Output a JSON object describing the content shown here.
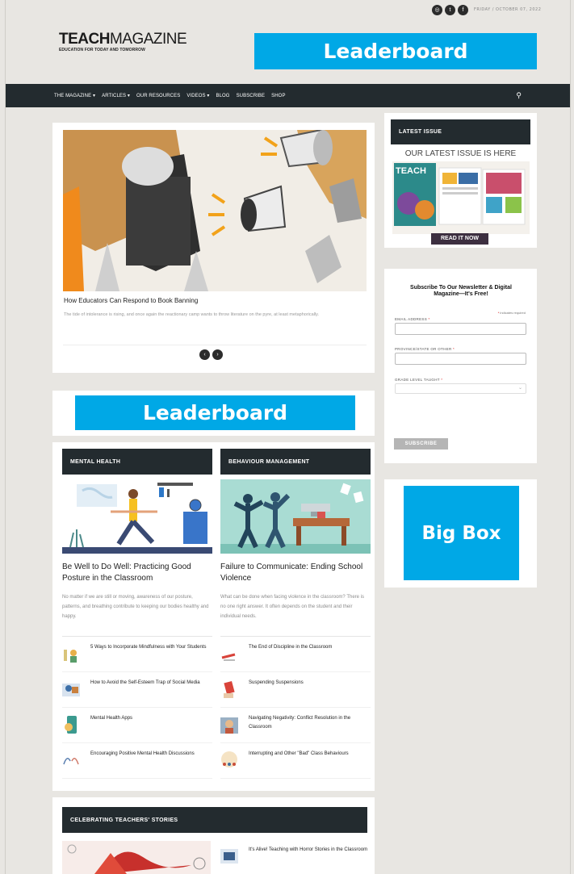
{
  "header": {
    "social_icons": [
      "instagram-icon",
      "twitter-icon",
      "facebook-icon"
    ],
    "social_glyphs": [
      "◎",
      "t",
      "f"
    ],
    "date": "FRIDAY / OCTOBER 07, 2022",
    "logo_bold": "TEACH",
    "logo_light": "MAGAZINE",
    "logo_tagline": "EDUCATION FOR TODAY AND TOMORROW",
    "ad_label": "Leaderboard"
  },
  "nav": {
    "items": [
      "THE MAGAZINE ▾",
      "ARTICLES ▾",
      "OUR RESOURCES",
      "VIDEOS ▾",
      "BLOG",
      "SUBSCRIBE",
      "SHOP"
    ],
    "search_glyph": "⚲"
  },
  "feature": {
    "title": "How Educators Can Respond to Book Banning",
    "description": "The tide of intolerance is rising, and once again the reactionary camp wants to throw literature on the pyre, at least metaphorically.",
    "prev_glyph": "‹",
    "next_glyph": "›"
  },
  "mid_ad": {
    "label": "Leaderboard"
  },
  "columns": {
    "left": {
      "heading": "MENTAL HEALTH",
      "title": "Be Well to Do Well: Practicing Good Posture in the Classroom",
      "description": "No matter if we are still or moving, awareness of our posture, patterns, and breathing contribute to keeping our bodies healthy and happy.",
      "links": [
        "5 Ways to Incorporate Mindfulness with Your Students",
        "How to Avoid the Self-Esteem Trap of Social Media",
        "Mental Health Apps",
        "Encouraging Positive Mental Health Discussions"
      ]
    },
    "right": {
      "heading": "BEHAVIOUR MANAGEMENT",
      "title": "Failure to Communicate: Ending School Violence",
      "description": "What can be done when facing violence in the classroom? There is no one right answer. It often depends on the student and their individual needs.",
      "links": [
        "The End of Discipline in the Classroom",
        "Suspending Suspensions",
        "Navigating Negativity: Conflict Resolution in the Classroom",
        "Interrupting and Other \"Bad\" Class Behaviours"
      ]
    }
  },
  "celebrate": {
    "heading": "CELEBRATING TEACHERS' STORIES",
    "link": "It's Alive! Teaching with Horror Stories in the Classroom"
  },
  "sidebar": {
    "latest_heading": "LATEST ISSUE",
    "latest_text": "OUR LATEST ISSUE IS HERE",
    "cover_title": "TEACH",
    "read_button": "READ IT NOW",
    "newsletter_title": "Subscribe To Our Newsletter & Digital Magazine—It's Free!",
    "required_star": "*",
    "required_note": " indicates required",
    "email_label": "EMAIL ADDRESS",
    "province_label": "PROVINCE/STATE OR OTHER",
    "grade_label": "GRADE LEVEL TAUGHT",
    "field_star": " *",
    "select_caret": "⌄",
    "subscribe_button": "SUBSCRIBE",
    "bigbox_label": "Big Box"
  },
  "colors": {
    "ad_blue": "#00a8e6",
    "nav_dark": "#232b2f",
    "page_bg": "#e8e6e2"
  }
}
